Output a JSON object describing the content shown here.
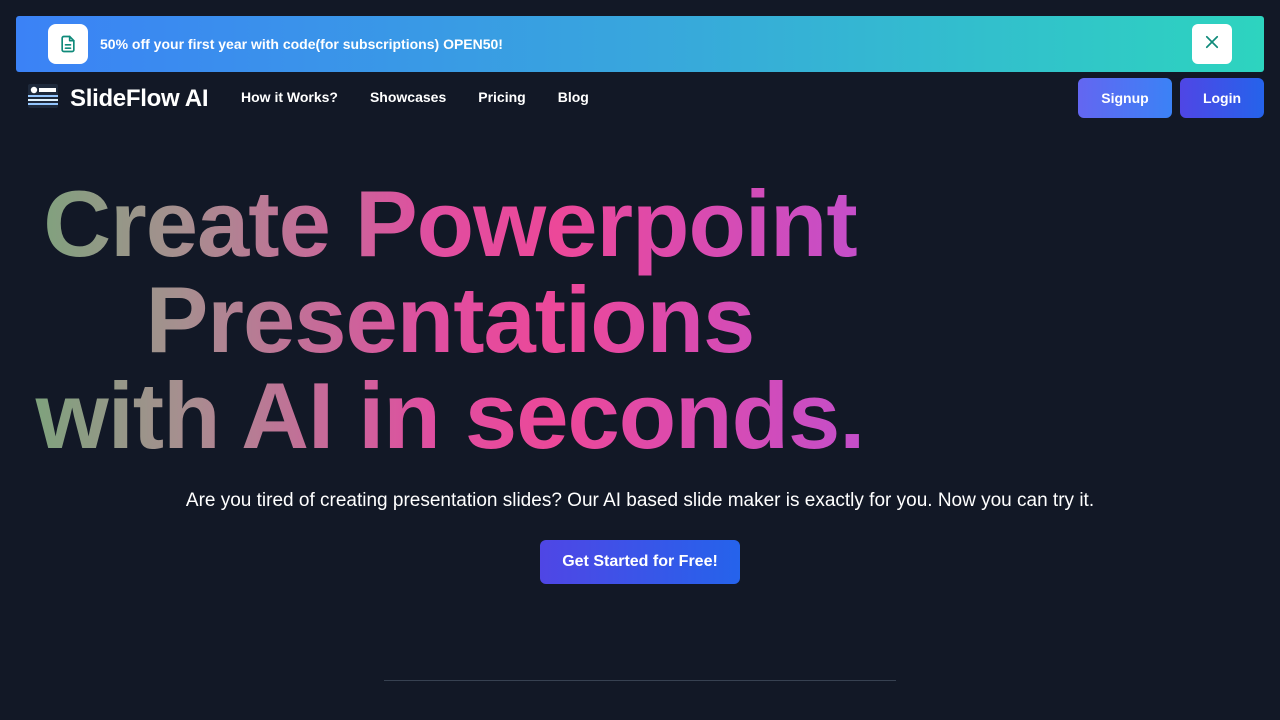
{
  "banner": {
    "text": "50% off your first year with code(for subscriptions) ",
    "code": "OPEN50!",
    "icon": "document-icon",
    "close_icon": "close-icon",
    "colors": {
      "start": "#3b82f6",
      "end": "#2dd4bf"
    }
  },
  "nav": {
    "logo_text": "SlideFlow AI",
    "links": [
      "How it Works?",
      "Showcases",
      "Pricing",
      "Blog"
    ],
    "signup_label": "Signup",
    "login_label": "Login"
  },
  "hero": {
    "title_line1": "Create Powerpoint",
    "title_line2": "Presentations",
    "title_line3": "with AI in seconds.",
    "subtitle": "Are you tired of creating presentation slides? Our AI based slide maker is exactly for you. Now you can try it.",
    "cta_label": "Get Started for Free!"
  },
  "colors": {
    "background": "#121826",
    "accent": "#4f46e5",
    "title_gradient": [
      "#7fa27d",
      "#ec4899",
      "#bf4fd0"
    ]
  }
}
